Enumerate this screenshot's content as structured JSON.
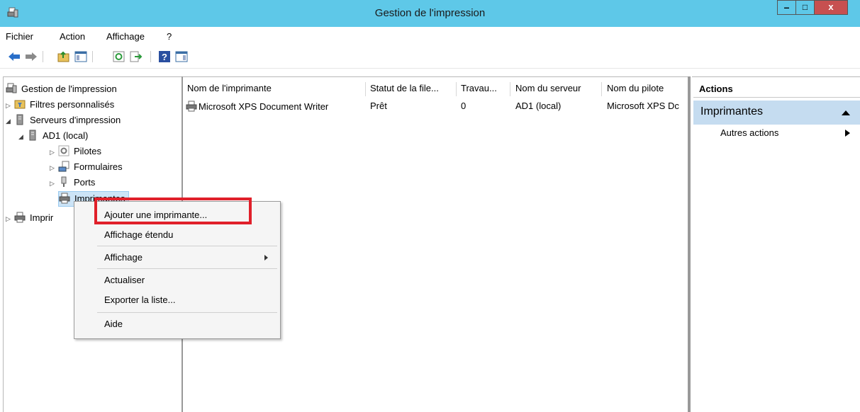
{
  "window": {
    "title": "Gestion de l'impression",
    "minimize": "–",
    "maximize": "□",
    "close": "x",
    "accent": "#5ec8e8",
    "close_color": "#c75050"
  },
  "menubar": [
    "Fichier",
    "Action",
    "Affichage",
    "?"
  ],
  "toolbar": {
    "icons": [
      "back-icon",
      "forward-icon",
      "up-folder-icon",
      "show-tree-icon",
      "refresh-icon",
      "export-icon",
      "help-icon",
      "show-action-pane-icon"
    ]
  },
  "tree": {
    "root": "Gestion de l'impression",
    "filters": "Filtres personnalisés",
    "servers": "Serveurs d'impression",
    "server": "AD1 (local)",
    "drivers": "Pilotes",
    "forms": "Formulaires",
    "ports": "Ports",
    "printers_selected": "Imprimantes",
    "deployed_printers_partial": "Imprir"
  },
  "list": {
    "columns": [
      "Nom de l'imprimante",
      "Statut de la file...",
      "Travau...",
      "Nom du serveur",
      "Nom du pilote"
    ],
    "rows": [
      {
        "name": "Microsoft XPS Document Writer",
        "status": "Prêt",
        "jobs": "0",
        "server": "AD1 (local)",
        "driver": "Microsoft XPS Dc"
      }
    ]
  },
  "actions": {
    "header": "Actions",
    "group": "Imprimantes",
    "items": [
      "Autres actions"
    ]
  },
  "context_menu": {
    "items": [
      "Ajouter une imprimante...",
      "Affichage étendu",
      "Affichage",
      "Actualiser",
      "Exporter la liste...",
      "Aide"
    ],
    "highlight_color": "#e0202a"
  }
}
